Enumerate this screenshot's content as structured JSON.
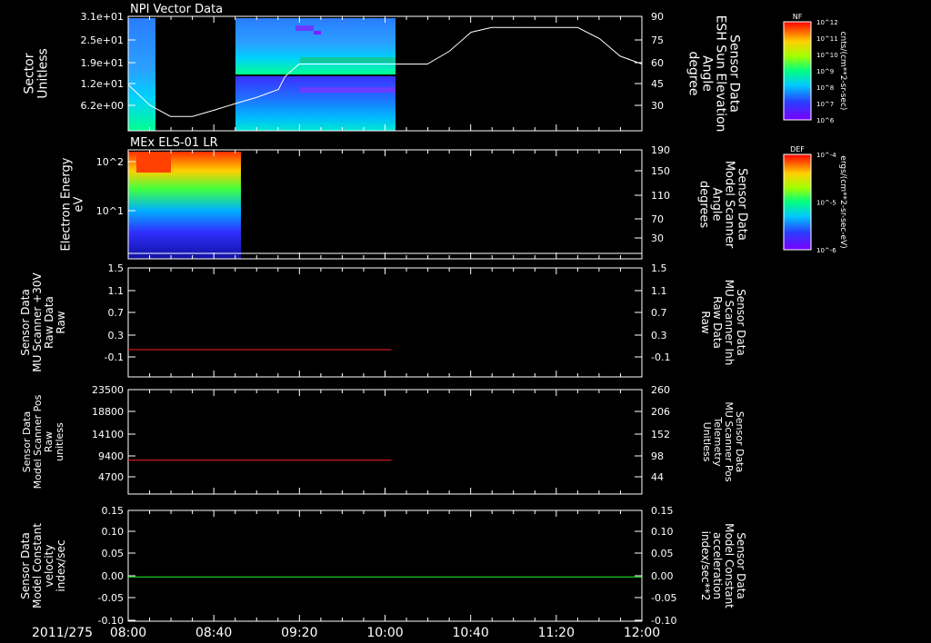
{
  "date_label": "2011/275",
  "time_ticks": [
    "08:00",
    "08:40",
    "09:20",
    "10:00",
    "10:40",
    "11:20",
    "12:00"
  ],
  "colors": {
    "red": "#ff2020",
    "green": "#20ff20",
    "line": "#ffffff"
  },
  "chart_data": [
    {
      "type": "heatmap",
      "title": "NPI Vector Data",
      "ylabel": [
        "Sector",
        "Unitless"
      ],
      "yticks": [
        "3.1e+01",
        "2.5e+01",
        "1.9e+01",
        "1.2e+01",
        "6.2e+00"
      ],
      "right_ylabel": [
        "Sensor Data",
        "ESH Sun Elevation",
        "Angle",
        "degree"
      ],
      "right_yticks": [
        "90",
        "75",
        "60",
        "45",
        "30"
      ],
      "right_ylim": [
        18,
        90
      ],
      "colorbar": {
        "label": "NF",
        "unit": "cnts/(cm**2-sr-sec)",
        "ticks": [
          "10^12",
          "10^11",
          "10^10",
          "10^9",
          "10^8",
          "10^7",
          "10^6"
        ]
      },
      "overlay_line": {
        "x_hours": [
          8.0,
          8.17,
          8.33,
          8.5,
          8.67,
          8.83,
          9.0,
          9.17,
          9.22,
          9.33,
          9.5,
          9.67,
          10.0,
          10.33,
          10.5,
          10.67,
          10.83,
          11.0,
          11.33,
          11.5,
          11.67,
          11.83,
          12.0
        ],
        "y_deg": [
          47,
          34,
          27,
          27,
          31,
          35,
          39,
          44,
          52,
          60,
          60,
          60,
          60,
          60,
          68,
          80,
          83,
          83,
          83,
          83,
          76,
          65,
          60
        ]
      }
    },
    {
      "type": "heatmap",
      "title": "MEx ELS-01 LR",
      "ylabel": [
        "Electron Energy",
        "eV"
      ],
      "yticks": [
        "10^2",
        "10^1"
      ],
      "right_ylabel": [
        "Sensor Data",
        "Model Scanner",
        "Angle",
        "degrees"
      ],
      "right_yticks": [
        "190",
        "150",
        "110",
        "70",
        "30"
      ],
      "colorbar": {
        "label": "DEF",
        "unit": "ergs/(cm**2-sr-sec-eV)",
        "ticks": [
          "10^-4",
          "10^-5",
          "10^-6"
        ]
      },
      "overlay_line": {
        "x_hours": [
          8.0,
          12.0
        ],
        "y_deg": [
          10,
          10
        ]
      }
    },
    {
      "type": "line",
      "ylabel": [
        "Sensor Data",
        "MU Scanner +30V",
        "Raw Data",
        "Raw"
      ],
      "yticks": [
        "1.5",
        "1.1",
        "0.7",
        "0.3",
        "-0.1"
      ],
      "ylim": [
        -0.5,
        1.5
      ],
      "right_ylabel": [
        "Sensor Data",
        "MU Scanner Inh",
        "Raw Data",
        "Raw"
      ],
      "right_yticks": [
        "1.5",
        "1.1",
        "0.7",
        "0.3",
        "-0.1"
      ],
      "series": [
        {
          "x_hours": [
            8.0,
            10.05
          ],
          "y": [
            0.0,
            0.0
          ]
        }
      ]
    },
    {
      "type": "line",
      "ylabel": [
        "Sensor Data",
        "Model Scanner Pos",
        "Raw",
        "unitless"
      ],
      "yticks": [
        "23500",
        "18800",
        "14100",
        "9400",
        "4700"
      ],
      "ylim": [
        0,
        23500
      ],
      "right_ylabel": [
        "Sensor Data",
        "MU Scanner Pos",
        "Telemetry",
        "Unitless"
      ],
      "right_yticks": [
        "260",
        "206",
        "152",
        "98",
        "44"
      ],
      "series": [
        {
          "x_hours": [
            8.0,
            10.05
          ],
          "y": [
            7600,
            7600
          ]
        }
      ]
    },
    {
      "type": "line",
      "ylabel": [
        "Sensor Data",
        "Model Constant",
        "velocity",
        "index/sec"
      ],
      "yticks": [
        "0.15",
        "0.10",
        "0.05",
        "0.00",
        "-0.05",
        "-0.10"
      ],
      "ylim": [
        -0.1,
        0.15
      ],
      "right_ylabel": [
        "Sensor Data",
        "Model Constant",
        "acceleration",
        "index/sec**2"
      ],
      "right_yticks": [
        "0.15",
        "0.10",
        "0.05",
        "0.00",
        "-0.05",
        "-0.10"
      ],
      "series": [
        {
          "x_hours": [
            8.0,
            12.0
          ],
          "y": [
            0.0,
            0.0
          ]
        }
      ]
    }
  ]
}
